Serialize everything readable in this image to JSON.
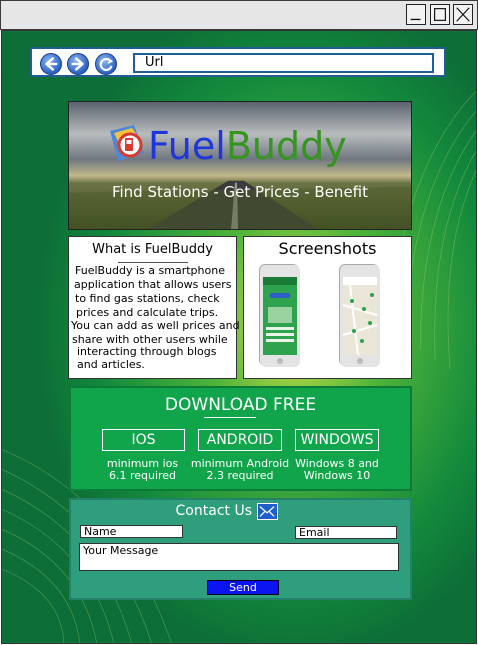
{
  "browser": {
    "url": "Url"
  },
  "hero": {
    "brand_part1": "Fuel",
    "brand_part2": "Buddy",
    "tagline": "Find Stations - Get Prices - Benefit"
  },
  "about": {
    "title": "What is FuelBuddy",
    "lines": [
      "FuelBuddy is a smartphone",
      "application that allows users",
      "to find gas stations, check",
      "prices and calculate trips.",
      "You can add as well prices and",
      "share with other users while",
      "interacting through blogs",
      "and articles."
    ]
  },
  "screenshots": {
    "title": "Screenshots"
  },
  "download": {
    "title": "DOWNLOAD FREE",
    "platforms": [
      {
        "label": "IOS",
        "req1": "minimum ios",
        "req2": "6.1 required"
      },
      {
        "label": "ANDROID",
        "req1": "minimum Android",
        "req2": "2.3 required"
      },
      {
        "label": "WINDOWS",
        "req1": "Windows 8 and",
        "req2": "Windows 10"
      }
    ]
  },
  "contact": {
    "title": "Contact Us",
    "name_placeholder": "Name",
    "email_placeholder": "Email",
    "message_placeholder": "Your Message",
    "send_label": "Send"
  },
  "icons": {
    "back": "back-arrow-icon",
    "forward": "forward-arrow-icon",
    "reload": "reload-icon",
    "minimize": "minimize-icon",
    "maximize": "maximize-icon",
    "close": "close-icon",
    "mail": "mail-icon"
  },
  "colors": {
    "page_bg": "#117a3e",
    "download_bg": "#10a54a",
    "contact_bg": "#2e9e7c",
    "send_bg": "#0a14ee",
    "brand_blue": "#1f36d8",
    "brand_green": "#35951f"
  }
}
